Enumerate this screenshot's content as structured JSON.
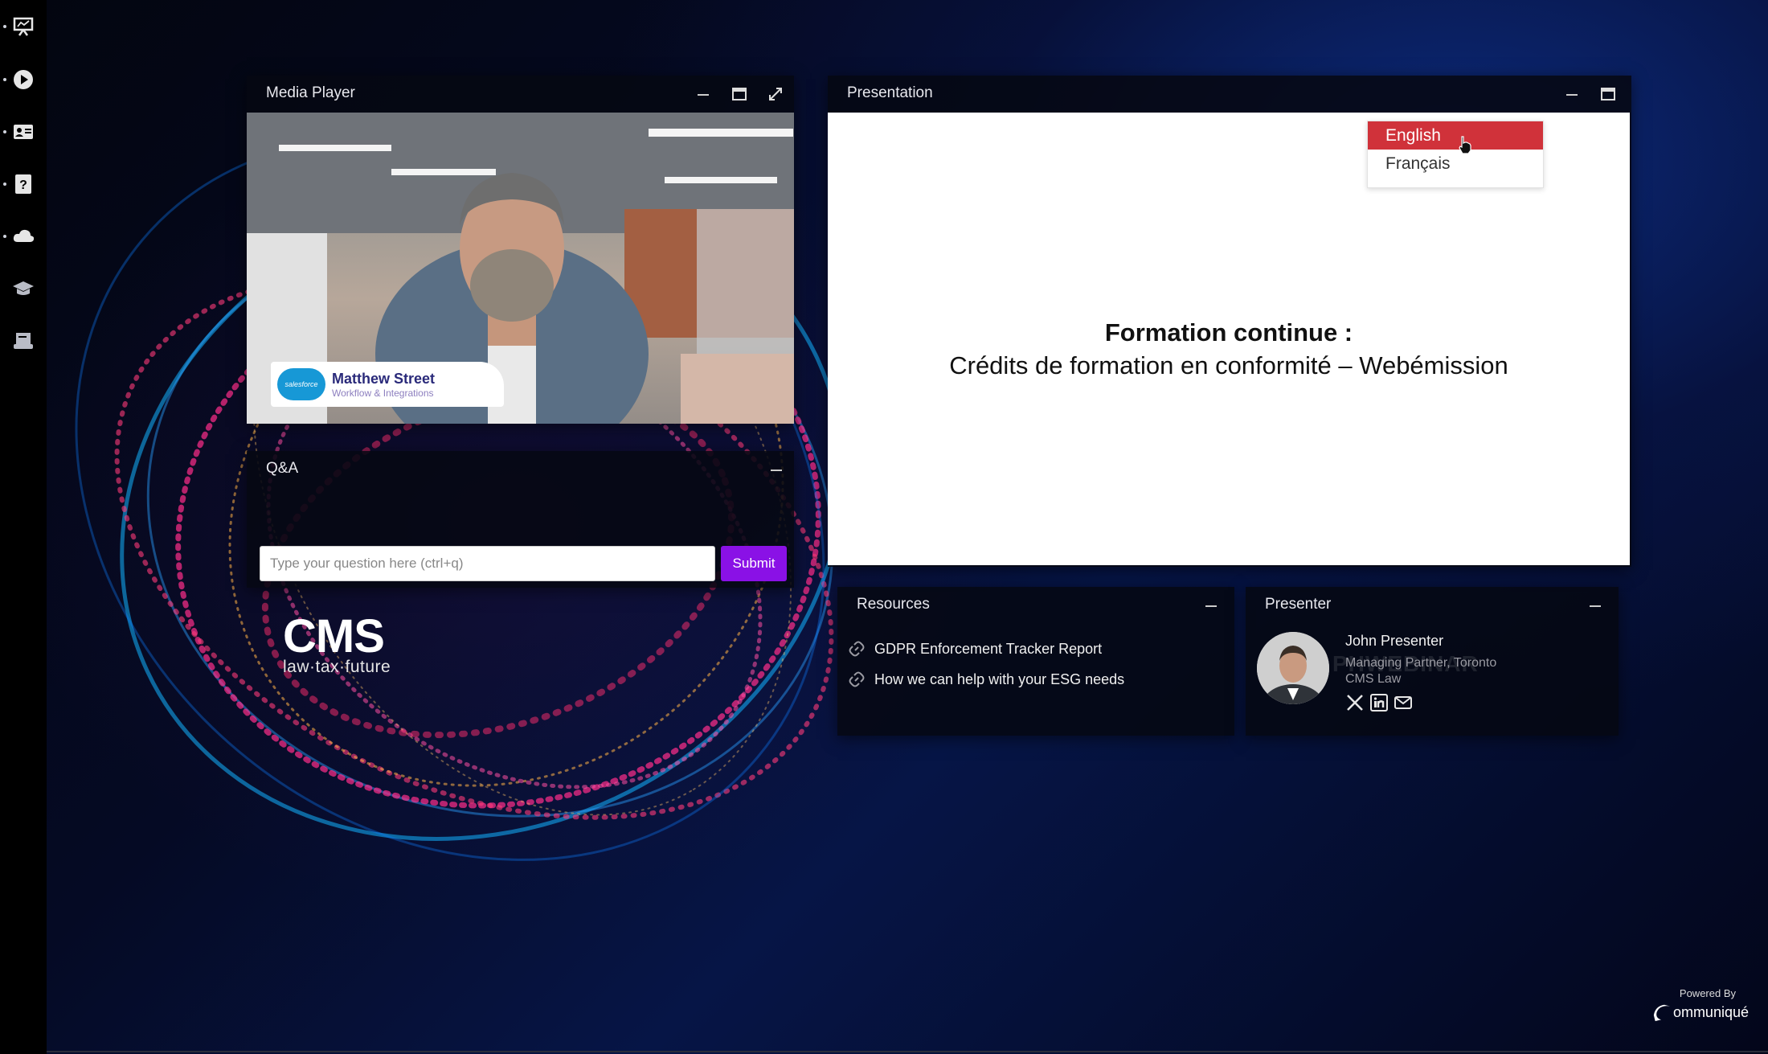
{
  "media_player": {
    "title": "Media Player",
    "video": {
      "name_tag_name": "Matthew Street",
      "name_tag_subtitle": "Workflow & Integrations",
      "name_tag_logo": "salesforce"
    }
  },
  "qa": {
    "title": "Q&A",
    "input_placeholder": "Type your question here (ctrl+q)",
    "submit_label": "Submit"
  },
  "cms_logo": {
    "wordmark": "CMS",
    "tagline": "law·tax·future"
  },
  "presentation": {
    "title": "Presentation",
    "slide_title": "Formation continue :",
    "slide_subtitle": "Crédits de formation en conformité – Webémission",
    "language_menu": {
      "options": [
        "English",
        "Français"
      ],
      "selected": "English",
      "selected_color": "#d0323a"
    }
  },
  "resources": {
    "title": "Resources",
    "items": [
      {
        "label": "GDPR Enforcement Tracker Report",
        "icon": "link-icon"
      },
      {
        "label": "How we can help with your ESG needs",
        "icon": "link-icon"
      }
    ]
  },
  "presenter": {
    "title": "Presenter",
    "name": "John Presenter",
    "role": "Managing Partner, Toronto",
    "organization": "CMS Law",
    "watermark": "PHWEBINAR",
    "social": [
      "x-icon",
      "linkedin-icon",
      "email-icon"
    ]
  },
  "powered_by": {
    "label": "Powered By",
    "brand": "ommuniqué"
  },
  "nav": {
    "items": [
      "presentation-icon",
      "play-icon",
      "contact-card-icon",
      "help-icon",
      "cloud-icon",
      "graduation-cap-icon",
      "certificate-icon"
    ]
  },
  "colors": {
    "accent": "#8a11e6",
    "menu_selected": "#d0323a",
    "background": "#050a24"
  }
}
